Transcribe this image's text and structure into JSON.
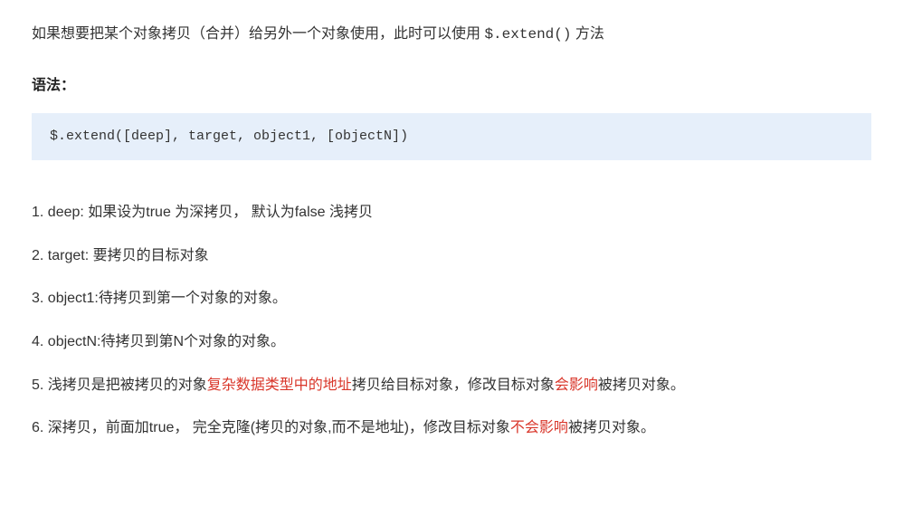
{
  "intro": {
    "prefix": "如果想要把某个对象拷贝（合并）给另外一个对象使用，此时可以使用 ",
    "code": "$.extend()",
    "suffix": " 方法"
  },
  "syntax_label": "语法：",
  "code_block": "$.extend([deep], target, object1, [objectN])",
  "items": [
    {
      "num": "1.",
      "segments": [
        {
          "text": " deep: 如果设为true 为深拷贝， 默认为false  浅拷贝",
          "red": false
        }
      ]
    },
    {
      "num": "2.",
      "segments": [
        {
          "text": " target: 要拷贝的目标对象",
          "red": false
        }
      ]
    },
    {
      "num": "3.",
      "segments": [
        {
          "text": " object1:待拷贝到第一个对象的对象。",
          "red": false
        }
      ]
    },
    {
      "num": "4.",
      "segments": [
        {
          "text": " objectN:待拷贝到第N个对象的对象。",
          "red": false
        }
      ]
    },
    {
      "num": "5.",
      "segments": [
        {
          "text": " 浅拷贝是把被拷贝的对象",
          "red": false
        },
        {
          "text": "复杂数据类型中的地址",
          "red": true
        },
        {
          "text": "拷贝给目标对象，修改目标对象",
          "red": false
        },
        {
          "text": "会影响",
          "red": true
        },
        {
          "text": "被拷贝对象。",
          "red": false
        }
      ]
    },
    {
      "num": "6.",
      "segments": [
        {
          "text": " 深拷贝，前面加true， 完全克隆(拷贝的对象,而不是地址)，修改目标对象",
          "red": false
        },
        {
          "text": "不会影响",
          "red": true
        },
        {
          "text": "被拷贝对象。",
          "red": false
        }
      ]
    }
  ]
}
